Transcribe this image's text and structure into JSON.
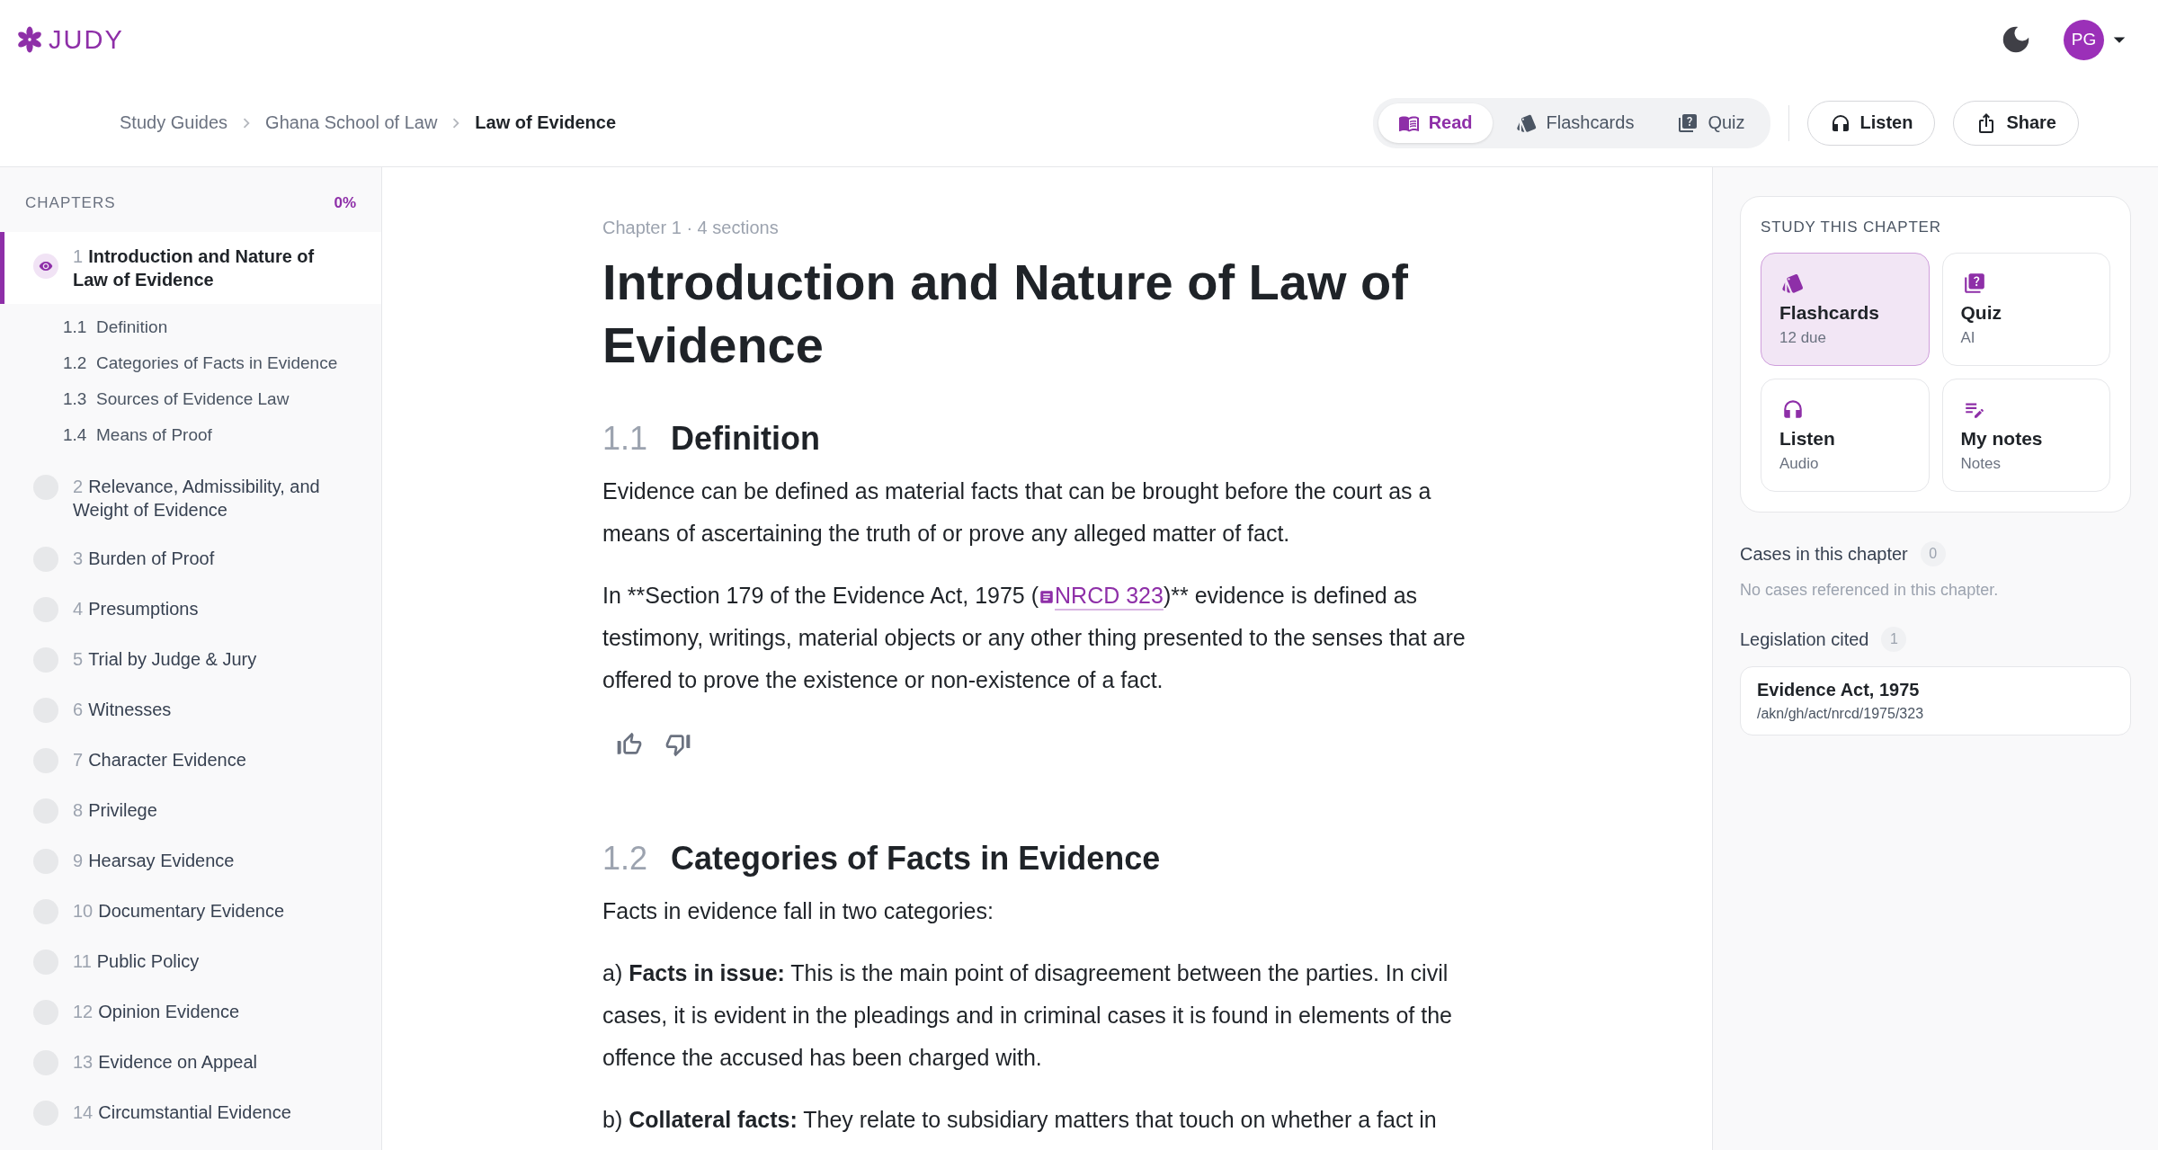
{
  "logo": "JUDY",
  "user": {
    "initials": "PG"
  },
  "breadcrumb": [
    "Study Guides",
    "Ghana School of Law",
    "Law of Evidence"
  ],
  "tabs": [
    {
      "label": "Read",
      "selected": true
    },
    {
      "label": "Flashcards",
      "selected": false
    },
    {
      "label": "Quiz",
      "selected": false
    }
  ],
  "actions": [
    "Listen",
    "Share"
  ],
  "sidebar": {
    "heading": "CHAPTERS",
    "progress": "0%",
    "chapters": [
      {
        "number": "1",
        "title": "Introduction and Nature of Law of Evidence",
        "selected": true,
        "children": [
          {
            "number": "1.1",
            "title": "Definition"
          },
          {
            "number": "1.2",
            "title": "Categories of Facts in Evidence"
          },
          {
            "number": "1.3",
            "title": "Sources of Evidence Law"
          },
          {
            "number": "1.4",
            "title": "Means of Proof"
          }
        ]
      },
      {
        "number": "2",
        "title": "Relevance, Admissibility, and Weight of Evidence",
        "selected": false
      },
      {
        "number": "3",
        "title": "Burden of Proof",
        "selected": false
      },
      {
        "number": "4",
        "title": "Presumptions",
        "selected": false
      },
      {
        "number": "5",
        "title": "Trial by Judge & Jury",
        "selected": false
      },
      {
        "number": "6",
        "title": "Witnesses",
        "selected": false
      },
      {
        "number": "7",
        "title": "Character Evidence",
        "selected": false
      },
      {
        "number": "8",
        "title": "Privilege",
        "selected": false
      },
      {
        "number": "9",
        "title": "Hearsay Evidence",
        "selected": false
      },
      {
        "number": "10",
        "title": "Documentary Evidence",
        "selected": false
      },
      {
        "number": "11",
        "title": "Public Policy",
        "selected": false
      },
      {
        "number": "12",
        "title": "Opinion Evidence",
        "selected": false
      },
      {
        "number": "13",
        "title": "Evidence on Appeal",
        "selected": false
      },
      {
        "number": "14",
        "title": "Circumstantial Evidence",
        "selected": false
      }
    ]
  },
  "article": {
    "meta": "Chapter 1 · 4 sections",
    "title": "Introduction and Nature of Law of Evidence",
    "sections": [
      {
        "number": "1.1",
        "title": "Definition",
        "paragraphs": [
          {
            "kind": "text",
            "text": "Evidence can be defined as material facts that can be brought before the court as a means of ascertaining the truth of or prove any alleged matter of fact."
          },
          {
            "kind": "citation",
            "before": "In **Section 179 of the Evidence Act, 1975 (",
            "link": "NRCD 323",
            "after": ")** evidence is defined as testimony, writings, material objects or any other thing presented to the senses that are offered to prove the existence or non-existence of a fact."
          }
        ],
        "feedback": true
      },
      {
        "number": "1.2",
        "title": "Categories of Facts in Evidence",
        "paragraphs": [
          {
            "kind": "text",
            "text": "Facts in evidence fall in two categories:"
          },
          {
            "kind": "text",
            "text": "a) **Facts in issue:** This is the main point of disagreement between the parties. In civil cases, it is evident in the pleadings and in criminal cases it is found in elements of the offence the accused has been charged with."
          },
          {
            "kind": "text",
            "text": "b) **Collateral facts:** They relate to subsidiary matters that touch on whether a fact in"
          }
        ],
        "feedback": false
      }
    ]
  },
  "study": {
    "heading": "STUDY THIS CHAPTER",
    "cards": [
      {
        "title": "Flashcards",
        "subtitle": "12 due",
        "selected": true
      },
      {
        "title": "Quiz",
        "subtitle": "AI",
        "selected": false
      },
      {
        "title": "Listen",
        "subtitle": "Audio",
        "selected": false
      },
      {
        "title": "My notes",
        "subtitle": "Notes",
        "selected": false
      }
    ]
  },
  "cases": {
    "heading": "Cases in this chapter",
    "count": "0",
    "empty": "No cases referenced in this chapter."
  },
  "legislation": {
    "heading": "Legislation cited",
    "count": "1",
    "items": [
      {
        "title": "Evidence Act, 1975",
        "path": "/akn/gh/act/nrcd/1975/323"
      }
    ]
  }
}
